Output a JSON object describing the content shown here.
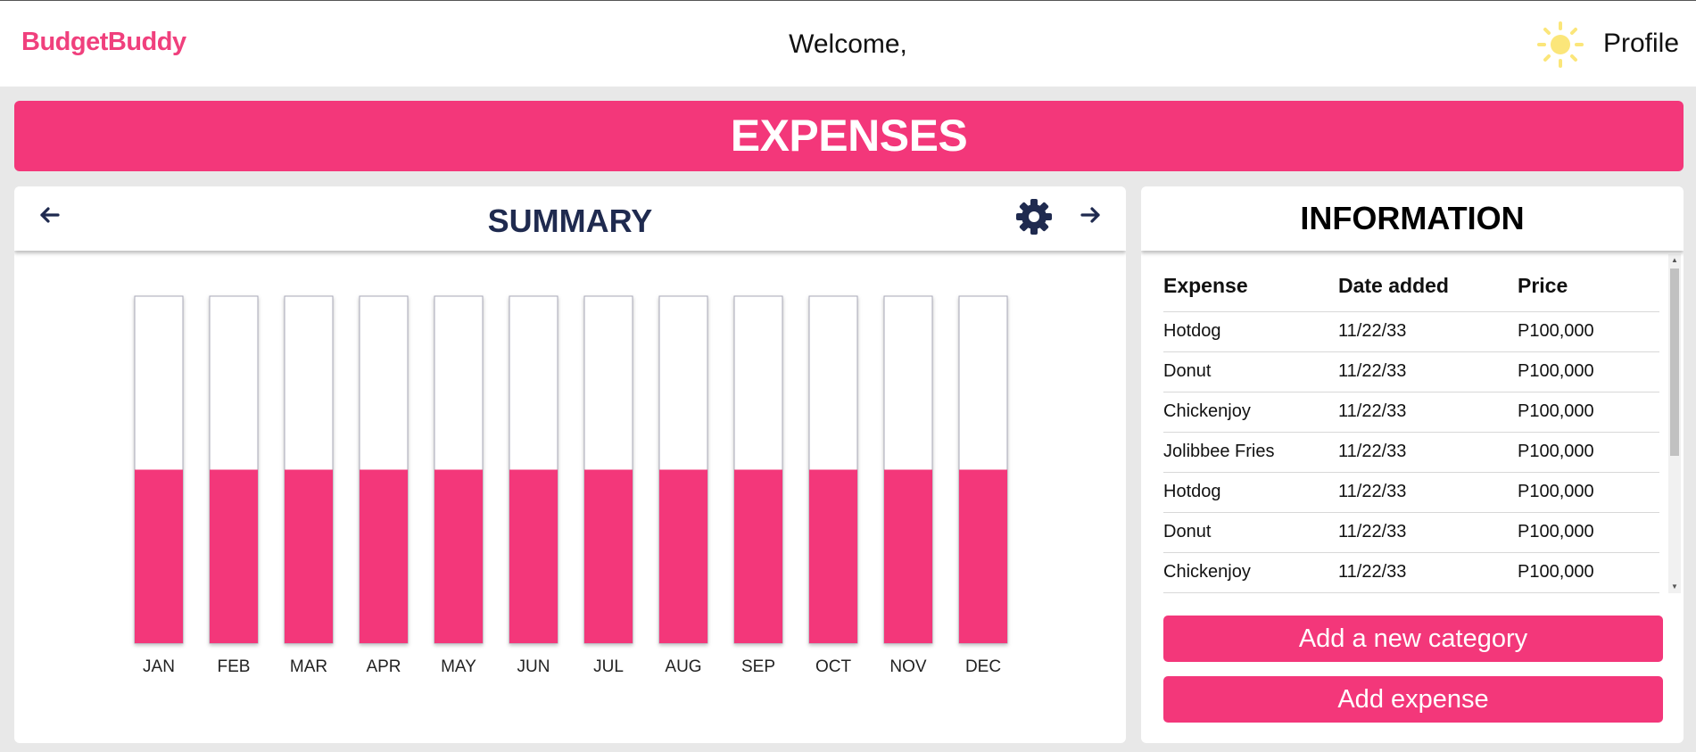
{
  "app": {
    "brand": "BudgetBuddy",
    "welcome": "Welcome,",
    "profile": "Profile"
  },
  "banner": {
    "title": "EXPENSES"
  },
  "summary": {
    "title": "SUMMARY"
  },
  "chart_data": {
    "type": "bar",
    "categories": [
      "JAN",
      "FEB",
      "MAR",
      "APR",
      "MAY",
      "JUN",
      "JUL",
      "AUG",
      "SEP",
      "OCT",
      "NOV",
      "DEC"
    ],
    "values": [
      50,
      50,
      50,
      50,
      50,
      50,
      50,
      50,
      50,
      50,
      50,
      50
    ],
    "ylim": [
      0,
      100
    ],
    "title": "",
    "xlabel": "",
    "ylabel": "",
    "bar_fill_color": "#f3377a",
    "bar_empty_color": "#ffffff",
    "grid": false
  },
  "information": {
    "title": "INFORMATION",
    "columns": [
      "Expense",
      "Date added",
      "Price"
    ],
    "rows": [
      [
        "Hotdog",
        "11/22/33",
        "P100,000"
      ],
      [
        "Donut",
        "11/22/33",
        "P100,000"
      ],
      [
        "Chickenjoy",
        "11/22/33",
        "P100,000"
      ],
      [
        "Jolibbee Fries",
        "11/22/33",
        "P100,000"
      ],
      [
        "Hotdog",
        "11/22/33",
        "P100,000"
      ],
      [
        "Donut",
        "11/22/33",
        "P100,000"
      ],
      [
        "Chickenjoy",
        "11/22/33",
        "P100,000"
      ]
    ]
  },
  "buttons": {
    "add_category": "Add a new category",
    "add_expense": "Add expense"
  },
  "icons": {
    "theme": "sun-icon",
    "prev": "arrow-left-icon",
    "next": "arrow-right-icon",
    "settings": "gear-icon"
  },
  "colors": {
    "accent": "#f3377a",
    "brand": "#f0407d",
    "header_text": "#1f2a4f",
    "sun": "#fbe67a"
  }
}
